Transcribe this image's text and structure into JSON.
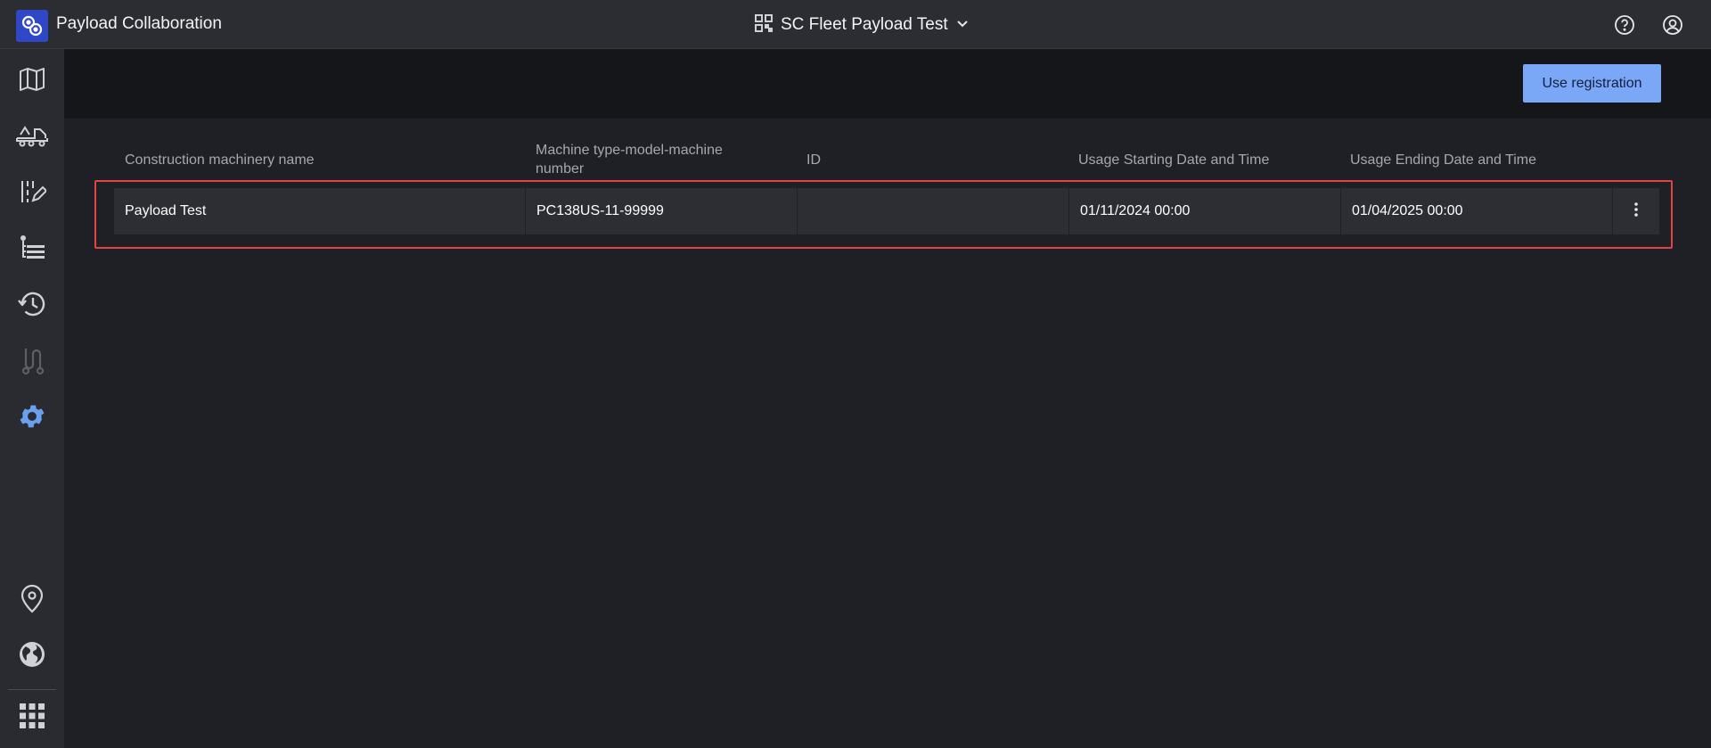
{
  "app": {
    "title": "Payload Collaboration"
  },
  "header": {
    "fleet_name": "SC Fleet Payload Test",
    "icons": [
      "help-icon",
      "account-icon"
    ]
  },
  "sidebar": {
    "items": [
      {
        "name": "map",
        "icon": "map-icon",
        "active": false
      },
      {
        "name": "vehicles",
        "icon": "truck-icon",
        "active": false
      },
      {
        "name": "edit",
        "icon": "edit-list-icon",
        "active": false
      },
      {
        "name": "list",
        "icon": "list-icon",
        "active": false
      },
      {
        "name": "history",
        "icon": "history-icon",
        "active": false
      },
      {
        "name": "route",
        "icon": "route-icon",
        "active": false,
        "disabled": true
      },
      {
        "name": "settings",
        "icon": "gear-icon",
        "active": true
      }
    ],
    "bottom_items": [
      {
        "name": "location",
        "icon": "location-pin-icon"
      },
      {
        "name": "globe",
        "icon": "globe-icon"
      },
      {
        "name": "apps",
        "icon": "app-grid-icon"
      }
    ]
  },
  "toolbar": {
    "registration_button": "Use registration"
  },
  "table": {
    "columns": [
      "Construction machinery name",
      "Machine type-model-machine number",
      "ID",
      "Usage Starting Date and Time",
      "Usage Ending Date and Time"
    ],
    "rows": [
      {
        "name": "Payload Test",
        "machine": "PC138US-11-99999",
        "id": "",
        "start": "01/11/2024 00:00",
        "end": "01/04/2025 00:00"
      }
    ]
  },
  "colors": {
    "accent": "#7aa7f6",
    "highlight_border": "#e0463f",
    "active_icon": "#6aa0f0"
  }
}
